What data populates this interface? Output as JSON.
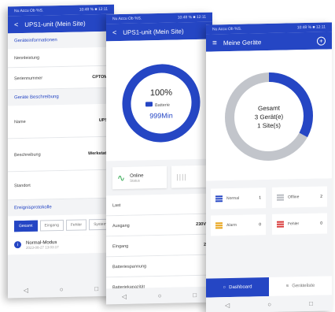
{
  "phone1": {
    "status_left": "Nu Accu Ob %S.",
    "status_right": "10:48 % ■ 12:11",
    "title": "UPS1-unit (Mein Site)",
    "sections": {
      "info_title": "Geräteinformationen",
      "desc_title": "Geräte Beschreibung",
      "events_title": "Ereignisprotokolle"
    },
    "info_rows": [
      {
        "label": "Nennleistung",
        "value": ""
      },
      {
        "label": "Seriennummer",
        "value": "CPTOM"
      }
    ],
    "desc_rows": [
      {
        "label": "Name",
        "value": "UPS"
      },
      {
        "label": "Beschreibung",
        "value": "Werkstatt"
      },
      {
        "label": "Standort",
        "value": ""
      }
    ],
    "tabs": [
      "Gesamt",
      "Eingang",
      "Fehler",
      "System"
    ],
    "event": {
      "title": "Normal-Modus",
      "time": "2023-08-27 13:03:17"
    }
  },
  "phone2": {
    "status_left": "Nu Accu Ob %S.",
    "status_right": "10:48 % ■ 12:11",
    "title": "UPS1-unit (Mein Site)",
    "gauge": {
      "percent": "100%",
      "label": "Batterie",
      "runtime": "999Min",
      "level": 1.0
    },
    "online": {
      "label": "Online",
      "sub": "Status"
    },
    "rows": [
      {
        "label": "Last",
        "value": ""
      },
      {
        "label": "Ausgang",
        "value": "230V"
      },
      {
        "label": "Eingang",
        "value": "2"
      },
      {
        "label": "Batteriespannung",
        "value": ""
      },
      {
        "label": "Batteriekapazität",
        "value": ""
      }
    ]
  },
  "phone3": {
    "status_left": "Nu Accu Ob %S.",
    "status_right": "10:48 % ■ 12:11",
    "title": "Meine Geräte",
    "donut": {
      "line1": "Gesamt",
      "line2": "3 Gerät(e)",
      "line3": "1 Site(s)",
      "blue_fraction": 0.33
    },
    "stats": [
      {
        "label": "Normal",
        "value": "1",
        "color": "#2546c4"
      },
      {
        "label": "Offline",
        "value": "2",
        "color": "#b9bcc2"
      },
      {
        "label": "Alarm",
        "value": "0",
        "color": "#e8a317"
      },
      {
        "label": "Fehler",
        "value": "0",
        "color": "#d93b3b"
      }
    ],
    "bottom": {
      "dashboard": "Dashboard",
      "list": "Geräteliste"
    }
  },
  "nav": {
    "back": "◁",
    "home": "○",
    "recent": "□"
  },
  "colors": {
    "primary": "#2546c4",
    "ring_grey": "#c2c5cb",
    "online_green": "#2aa54b"
  }
}
